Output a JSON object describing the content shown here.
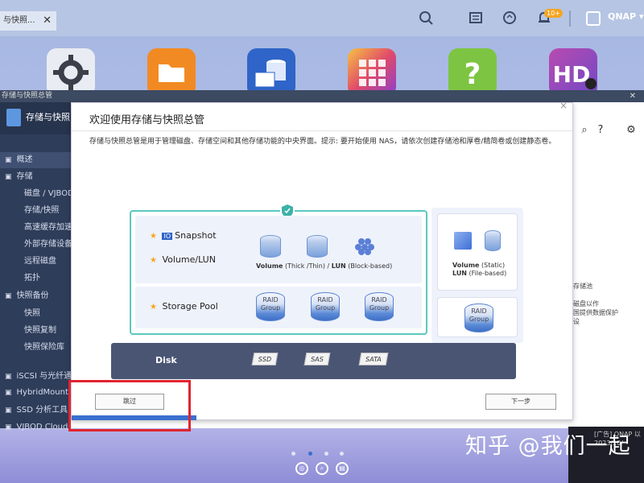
{
  "taskbar": {
    "tab_label": "与快照...",
    "tab_close": "✕",
    "notification_badge": "10+",
    "user_label": "QNAP ▾"
  },
  "desktop": {
    "apps": [
      {
        "icon": "gear-icon",
        "color": "#e9ecf2"
      },
      {
        "icon": "folder-icon",
        "color": "#f28a23"
      },
      {
        "icon": "storage-icon",
        "color": "#2f64c8"
      },
      {
        "icon": "app-center-icon",
        "color": "#e04a6a"
      },
      {
        "icon": "help-icon",
        "color": "#7dc443"
      },
      {
        "icon": "hd-station-icon",
        "color": "#b94bb0"
      }
    ]
  },
  "storage_window": {
    "title_bar": "存储与快照总管",
    "close": "✕",
    "header": "存储与快照",
    "sidebar": [
      {
        "label": "概述",
        "icon": true
      },
      {
        "label": "存储",
        "icon": true
      },
      {
        "label": "磁盘 / VJBOD",
        "icon": false
      },
      {
        "label": "存储/快照",
        "icon": false
      },
      {
        "label": "高速缓存加速",
        "icon": false
      },
      {
        "label": "外部存储设备",
        "icon": false
      },
      {
        "label": "远程磁盘",
        "icon": false
      },
      {
        "label": "拓扑",
        "icon": false
      },
      {
        "label": "快照备份",
        "icon": true
      },
      {
        "label": "快照",
        "icon": false
      },
      {
        "label": "快照复制",
        "icon": false
      },
      {
        "label": "快照保险库",
        "icon": false
      },
      {
        "label": "iSCSI 与光纤通",
        "icon": true
      },
      {
        "label": "HybridMount",
        "icon": true
      },
      {
        "label": "SSD 分析工具",
        "icon": true
      },
      {
        "label": "VJBOD Cloud",
        "icon": true
      }
    ],
    "right_panel_lines": [
      "存储池",
      "磁盘以作",
      "国提供数据保护",
      "设"
    ]
  },
  "modal": {
    "title": "欢迎使用存储与快照总管",
    "description": "存储与快照总管是用于管理磁盘、存储空间和其他存储功能的中央界面。提示: 要开始使用 NAS，请依次创建存储池和厚卷/精简卷或创建静态卷。",
    "diagram": {
      "snapshot_label": "Snapshot",
      "snapshot_badge": "IO",
      "volume_lun_label": "Volume/LUN",
      "volume_caption_bold": "Volume",
      "volume_caption_rest": " (Thick /Thin) / ",
      "lun_caption_bold": "LUN",
      "lun_caption_rest": " (Block-based)",
      "storage_pool_label": "Storage Pool",
      "raid_label": "RAID Group",
      "static_volume_bold": "Volume",
      "static_volume_rest": " (Static)",
      "static_lun_bold": "LUN",
      "static_lun_rest": " (File-based)",
      "disk_label": "Disk",
      "disk_types": [
        "SSD",
        "SAS",
        "SATA"
      ],
      "star": "★"
    },
    "skip_button": "跳过",
    "next_button": "下一步"
  },
  "watermark": "知乎 @我们一起",
  "ad_text": [
    "[广告] QNAP 以",
    "2023/10/"
  ]
}
